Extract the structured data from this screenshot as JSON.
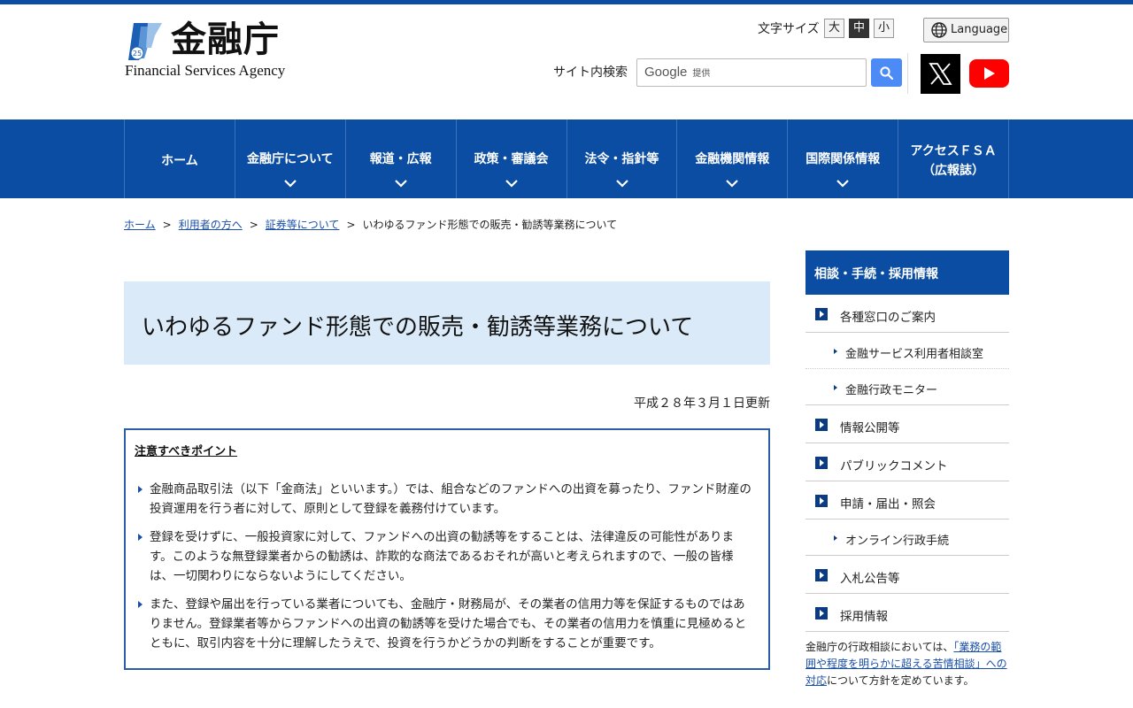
{
  "header": {
    "logo_jp": "金融庁",
    "logo_en": "Financial Services Agency",
    "logo_badge": "25",
    "font_size_label": "文字サイズ",
    "font_sizes": [
      "大",
      "中",
      "小"
    ],
    "font_size_selected": "中",
    "language_label": "Language",
    "search_label": "サイト内検索",
    "search_google": "Google",
    "search_provided": "提供",
    "social": [
      "x-icon",
      "youtube-icon"
    ]
  },
  "nav": [
    {
      "lines": [
        "ホーム"
      ],
      "dropdown": false
    },
    {
      "lines": [
        "金融庁について"
      ],
      "dropdown": true
    },
    {
      "lines": [
        "報道・広報"
      ],
      "dropdown": true
    },
    {
      "lines": [
        "政策・審議会"
      ],
      "dropdown": true
    },
    {
      "lines": [
        "法令・指針等"
      ],
      "dropdown": true
    },
    {
      "lines": [
        "金融機関情報"
      ],
      "dropdown": true
    },
    {
      "lines": [
        "国際関係情報"
      ],
      "dropdown": true
    },
    {
      "lines": [
        "アクセスＦＳＡ",
        "（広報誌）"
      ],
      "dropdown": false
    }
  ],
  "breadcrumb": {
    "links": [
      "ホーム",
      "利用者の方へ",
      "証券等について"
    ],
    "separator": ">",
    "current": "いわゆるファンド形態での販売・勧誘等業務について"
  },
  "main": {
    "title": "いわゆるファンド形態での販売・勧誘等業務について",
    "updated": "平成２８年３月１日更新",
    "notice_heading": "注意すべきポイント",
    "points": [
      "金融商品取引法（以下「金商法」といいます。）では、組合などのファンドへの出資を募ったり、ファンド財産の投資運用を行う者に対して、原則として登録を義務付けています。",
      "登録を受けずに、一般投資家に対して、ファンドへの出資の勧誘等をすることは、法律違反の可能性があります。このような無登録業者からの勧誘は、詐欺的な商法であるおそれが高いと考えられますので、一般の皆様は、一切関わりにならないようにしてください。",
      "また、登録や届出を行っている業者についても、金融庁・財務局が、その業者の信用力等を保証するものではありません。登録業者等からファンドへの出資の勧誘等を受けた場合でも、その業者の信用力を慎重に見極めるとともに、取引内容を十分に理解したうえで、投資を行うかどうかの判断をすることが重要です。"
    ]
  },
  "side": {
    "heading": "相談・手続・採用情報",
    "items": {
      "madoguchi": "各種窓口のご案内",
      "soudanshitsu": "金融サービス利用者相談室",
      "monitor": "金融行政モニター",
      "kokai": "情報公開等",
      "comment": "パブリックコメント",
      "shinsei": "申請・届出・照会",
      "online": "オンライン行政手続",
      "nyusatsu": "入札公告等",
      "saiyo": "採用情報"
    },
    "note_pre": "金融庁の行政相談においては、",
    "note_link": "「業務の範囲や程度を明らかに超える苦情相談」への対応",
    "note_post": "について方針を定めています。"
  },
  "colors": {
    "brand_blue": "#0b4da2",
    "title_bg": "#daeaf8",
    "link": "#1a4fa8",
    "search_button": "#4c8bf5",
    "youtube_red": "#ff0000"
  }
}
